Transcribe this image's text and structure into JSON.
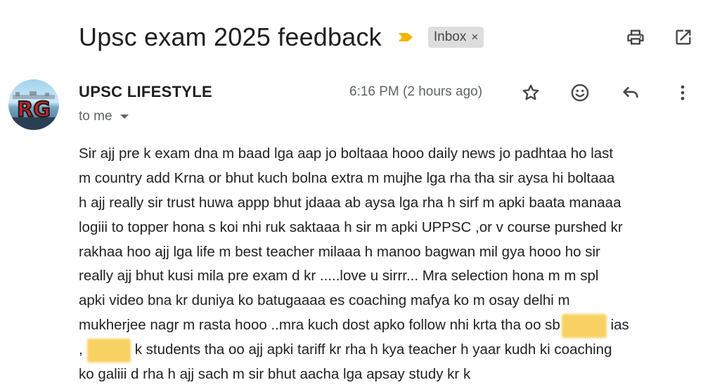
{
  "email": {
    "subject": "Upsc exam 2025 feedback",
    "label": "Inbox",
    "label_remove": "×",
    "sender_name": "UPSC LIFESTYLE",
    "sender_avatar_text": "RG",
    "recipient": "to me",
    "time": "6:16 PM (2 hours ago)"
  },
  "actions": {
    "print": "print-icon",
    "open_new_window": "open-in-new-icon",
    "star": "star-icon",
    "react": "emoji-icon",
    "reply": "reply-icon",
    "more": "more-vert-icon"
  },
  "body": {
    "line1": "Sir ajj pre k exam dna m baad lga aap jo boltaaa hooo daily news jo padhtaa ho last",
    "line2": "m country add Krna or bhut kuch bolna extra m mujhe lga rha tha sir aysa hi boltaaa",
    "line3": "h ajj really sir trust huwa appp bhut jdaaa ab aysa lga rha h sirf m apki baata manaaa",
    "line4": "logiii to topper hona s koi nhi ruk saktaaa h sir m apki UPPSC ,or v course purshed kr",
    "line5": "rakhaa hoo ajj lga life m best teacher milaaa h manoo bagwan mil gya hooo ho sir",
    "line6": "really ajj bhut kusi mila pre exam d kr .....love u sirrr... Mra selection hona m m spl",
    "line7": "apki video bna kr duniya ko batugaaaa es coaching mafya ko m osay delhi m",
    "line8a": "mukherjee nagr m rasta hooo ..mra kuch dost apko follow nhi krta tha oo sb",
    "line8b": "ias",
    "line9a": ",",
    "line9b": "k students tha oo ajj apki tariff kr rha h kya teacher h yaar kudh ki coaching",
    "line10": "ko galiii d rha h ajj sach m sir bhut aacha lga apsay study kr k"
  },
  "colors": {
    "importance_marker": "#f4b400",
    "redaction": "#f7c948",
    "label_bg": "#dddddd"
  }
}
